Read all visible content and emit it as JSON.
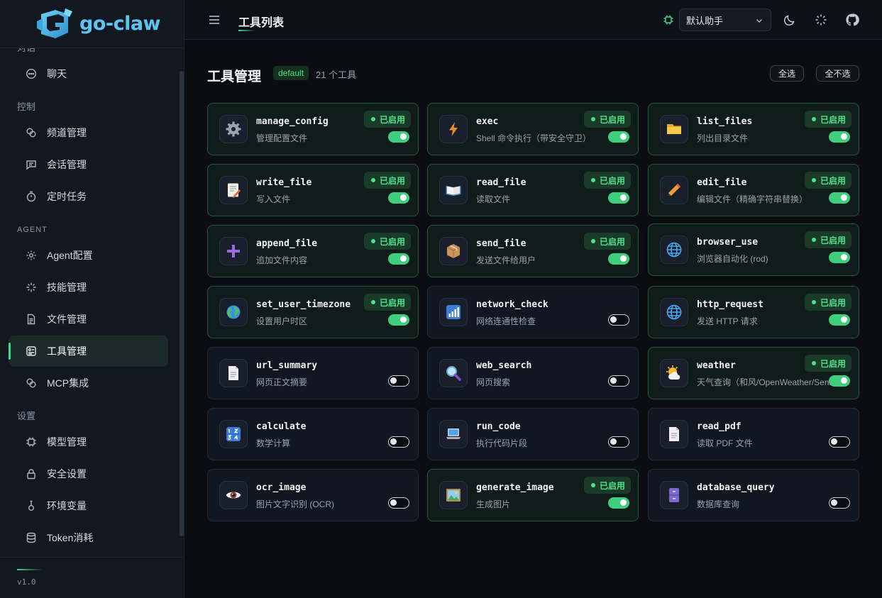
{
  "app": {
    "name": "go-claw",
    "version": "v1.0"
  },
  "colors": {
    "accent": "#3ddc84",
    "logo": "#5cc4f0",
    "background": "#0b0d12"
  },
  "sidebar": {
    "partial_section": "对话",
    "sections": [
      {
        "label": "对话",
        "items": [
          {
            "label": "聊天",
            "icon": "chat-bubble-icon"
          }
        ]
      },
      {
        "label": "控制",
        "items": [
          {
            "label": "频道管理",
            "icon": "link-icon"
          },
          {
            "label": "会话管理",
            "icon": "message-square-icon"
          },
          {
            "label": "定时任务",
            "icon": "timer-icon"
          }
        ]
      },
      {
        "label": "AGENT",
        "items": [
          {
            "label": "Agent配置",
            "icon": "gear-icon"
          },
          {
            "label": "技能管理",
            "icon": "sparkle-icon"
          },
          {
            "label": "文件管理",
            "icon": "file-icon"
          },
          {
            "label": "工具管理",
            "icon": "toolbox-icon",
            "active": true
          },
          {
            "label": "MCP集成",
            "icon": "link-icon"
          }
        ]
      },
      {
        "label": "设置",
        "items": [
          {
            "label": "模型管理",
            "icon": "chip-icon"
          },
          {
            "label": "安全设置",
            "icon": "lock-icon"
          },
          {
            "label": "环境变量",
            "icon": "flask-icon"
          },
          {
            "label": "Token消耗",
            "icon": "database-icon"
          }
        ]
      }
    ]
  },
  "topbar": {
    "page_title": "工具列表",
    "assistant_select": "默认助手",
    "icons": [
      "menu-icon",
      "chip-icon",
      "moon-icon",
      "loader-icon",
      "github-icon"
    ]
  },
  "header": {
    "title": "工具管理",
    "badge": "default",
    "count": "21 个工具",
    "select_all": "全选",
    "select_none": "全不选"
  },
  "status_label": "已启用",
  "tools": [
    {
      "name": "manage_config",
      "desc": "管理配置文件",
      "enabled": true,
      "icon": "gear-icon"
    },
    {
      "name": "exec",
      "desc": "Shell 命令执行（带安全守卫）",
      "enabled": true,
      "icon": "lightning-icon"
    },
    {
      "name": "list_files",
      "desc": "列出目录文件",
      "enabled": true,
      "icon": "folder-icon"
    },
    {
      "name": "write_file",
      "desc": "写入文件",
      "enabled": true,
      "icon": "memo-icon"
    },
    {
      "name": "read_file",
      "desc": "读取文件",
      "enabled": true,
      "icon": "open-book-icon"
    },
    {
      "name": "edit_file",
      "desc": "编辑文件（精确字符串替换）",
      "enabled": true,
      "icon": "pencil-icon"
    },
    {
      "name": "append_file",
      "desc": "追加文件内容",
      "enabled": true,
      "icon": "plus-icon"
    },
    {
      "name": "send_file",
      "desc": "发送文件给用户",
      "enabled": true,
      "icon": "package-icon"
    },
    {
      "name": "browser_use",
      "desc": "浏览器自动化 (rod)",
      "enabled": true,
      "icon": "globe-icon"
    },
    {
      "name": "set_user_timezone",
      "desc": "设置用户时区",
      "enabled": true,
      "icon": "earth-icon"
    },
    {
      "name": "network_check",
      "desc": "网络连通性检查",
      "enabled": false,
      "icon": "signal-bars-icon"
    },
    {
      "name": "http_request",
      "desc": "发送 HTTP 请求",
      "enabled": true,
      "icon": "globe-icon"
    },
    {
      "name": "url_summary",
      "desc": "网页正文摘要",
      "enabled": false,
      "icon": "page-icon"
    },
    {
      "name": "web_search",
      "desc": "网页搜索",
      "enabled": false,
      "icon": "magnifier-icon"
    },
    {
      "name": "weather",
      "desc": "天气查询（和风/OpenWeather/Seniverse）",
      "enabled": true,
      "icon": "sun-cloud-icon"
    },
    {
      "name": "calculate",
      "desc": "数学计算",
      "enabled": false,
      "icon": "numbers-icon"
    },
    {
      "name": "run_code",
      "desc": "执行代码片段",
      "enabled": false,
      "icon": "laptop-icon"
    },
    {
      "name": "read_pdf",
      "desc": "读取 PDF 文件",
      "enabled": false,
      "icon": "page-icon"
    },
    {
      "name": "ocr_image",
      "desc": "图片文字识别 (OCR)",
      "enabled": false,
      "icon": "eye-icon"
    },
    {
      "name": "generate_image",
      "desc": "生成图片",
      "enabled": true,
      "icon": "picture-icon"
    },
    {
      "name": "database_query",
      "desc": "数据库查询",
      "enabled": false,
      "icon": "cabinet-icon"
    }
  ]
}
